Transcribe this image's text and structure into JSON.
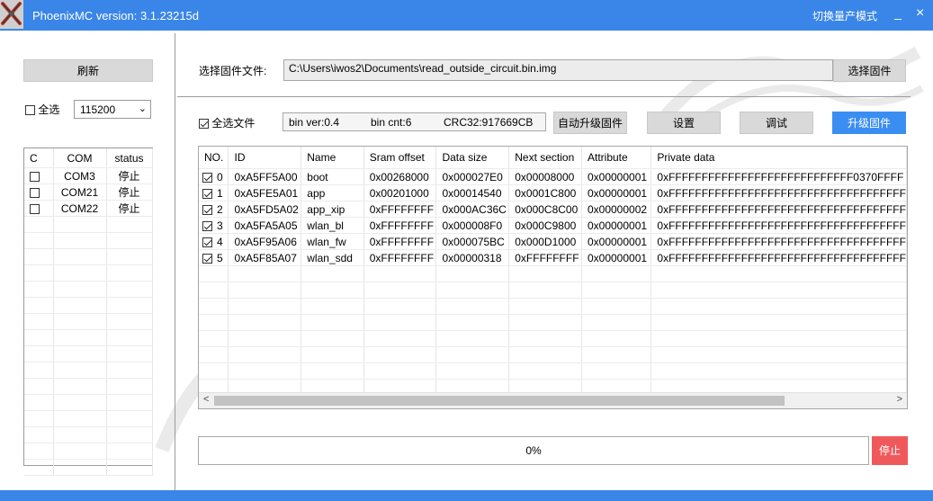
{
  "window": {
    "title": "PhoenixMC version: 3.1.23215d",
    "mode_switch": "切换量产模式",
    "minimize_glyph": "_",
    "close_glyph": "×",
    "logo_icon": "phoenix-logo-icon"
  },
  "left": {
    "refresh_label": "刷新",
    "select_all_label": "全选",
    "select_all_checked": false,
    "baud_value": "115200",
    "columns": [
      "C",
      "COM",
      "status"
    ],
    "ports": [
      {
        "checked": false,
        "com": "COM3",
        "status": "停止"
      },
      {
        "checked": false,
        "com": "COM21",
        "status": "停止"
      },
      {
        "checked": false,
        "com": "COM22",
        "status": "停止"
      }
    ]
  },
  "firmware": {
    "label": "选择固件文件:",
    "path": "C:\\Users\\iwos2\\Documents\\read_outside_circuit.bin.img",
    "choose_button": "选择固件"
  },
  "toolbar": {
    "select_all_files_label": "全选文件",
    "select_all_files_checked": true,
    "bin_ver": "bin ver:0.4",
    "bin_cnt": "bin cnt:6",
    "crc": "CRC32:917669CB",
    "auto_upgrade": "自动升级固件",
    "settings": "设置",
    "debug": "调试",
    "upgrade": "升级固件"
  },
  "sections": {
    "columns": [
      "NO.",
      "ID",
      "Name",
      "Sram offset",
      "Data size",
      "Next section",
      "Attribute",
      "Private data"
    ],
    "rows": [
      {
        "checked": true,
        "no": "0",
        "id": "0xA5FF5A00",
        "name": "boot",
        "sram": "0x00268000",
        "size": "0x000027E0",
        "next": "0x00008000",
        "attr": "0x00000001",
        "priv": "0xFFFFFFFFFFFFFFFFFFFFFFFFFFFF0370FFFF"
      },
      {
        "checked": true,
        "no": "1",
        "id": "0xA5FE5A01",
        "name": "app",
        "sram": "0x00201000",
        "size": "0x00014540",
        "next": "0x0001C800",
        "attr": "0x00000001",
        "priv": "0xFFFFFFFFFFFFFFFFFFFFFFFFFFFFFFFFFFFF"
      },
      {
        "checked": true,
        "no": "2",
        "id": "0xA5FD5A02",
        "name": "app_xip",
        "sram": "0xFFFFFFFF",
        "size": "0x000AC36C",
        "next": "0x000C8C00",
        "attr": "0x00000002",
        "priv": "0xFFFFFFFFFFFFFFFFFFFFFFFFFFFFFFFFFFFF"
      },
      {
        "checked": true,
        "no": "3",
        "id": "0xA5FA5A05",
        "name": "wlan_bl",
        "sram": "0xFFFFFFFF",
        "size": "0x000008F0",
        "next": "0x000C9800",
        "attr": "0x00000001",
        "priv": "0xFFFFFFFFFFFFFFFFFFFFFFFFFFFFFFFFFFFF"
      },
      {
        "checked": true,
        "no": "4",
        "id": "0xA5F95A06",
        "name": "wlan_fw",
        "sram": "0xFFFFFFFF",
        "size": "0x000075BC",
        "next": "0x000D1000",
        "attr": "0x00000001",
        "priv": "0xFFFFFFFFFFFFFFFFFFFFFFFFFFFFFFFFFFFF"
      },
      {
        "checked": true,
        "no": "5",
        "id": "0xA5F85A07",
        "name": "wlan_sdd",
        "sram": "0xFFFFFFFF",
        "size": "0x00000318",
        "next": "0xFFFFFFFF",
        "attr": "0x00000001",
        "priv": "0xFFFFFFFFFFFFFFFFFFFFFFFFFFFFFFFFFFFF"
      }
    ],
    "scroll_left_glyph": "<",
    "scroll_right_glyph": ">"
  },
  "progress": {
    "fraction": 0,
    "text": "0%",
    "stop_label": "停止"
  }
}
